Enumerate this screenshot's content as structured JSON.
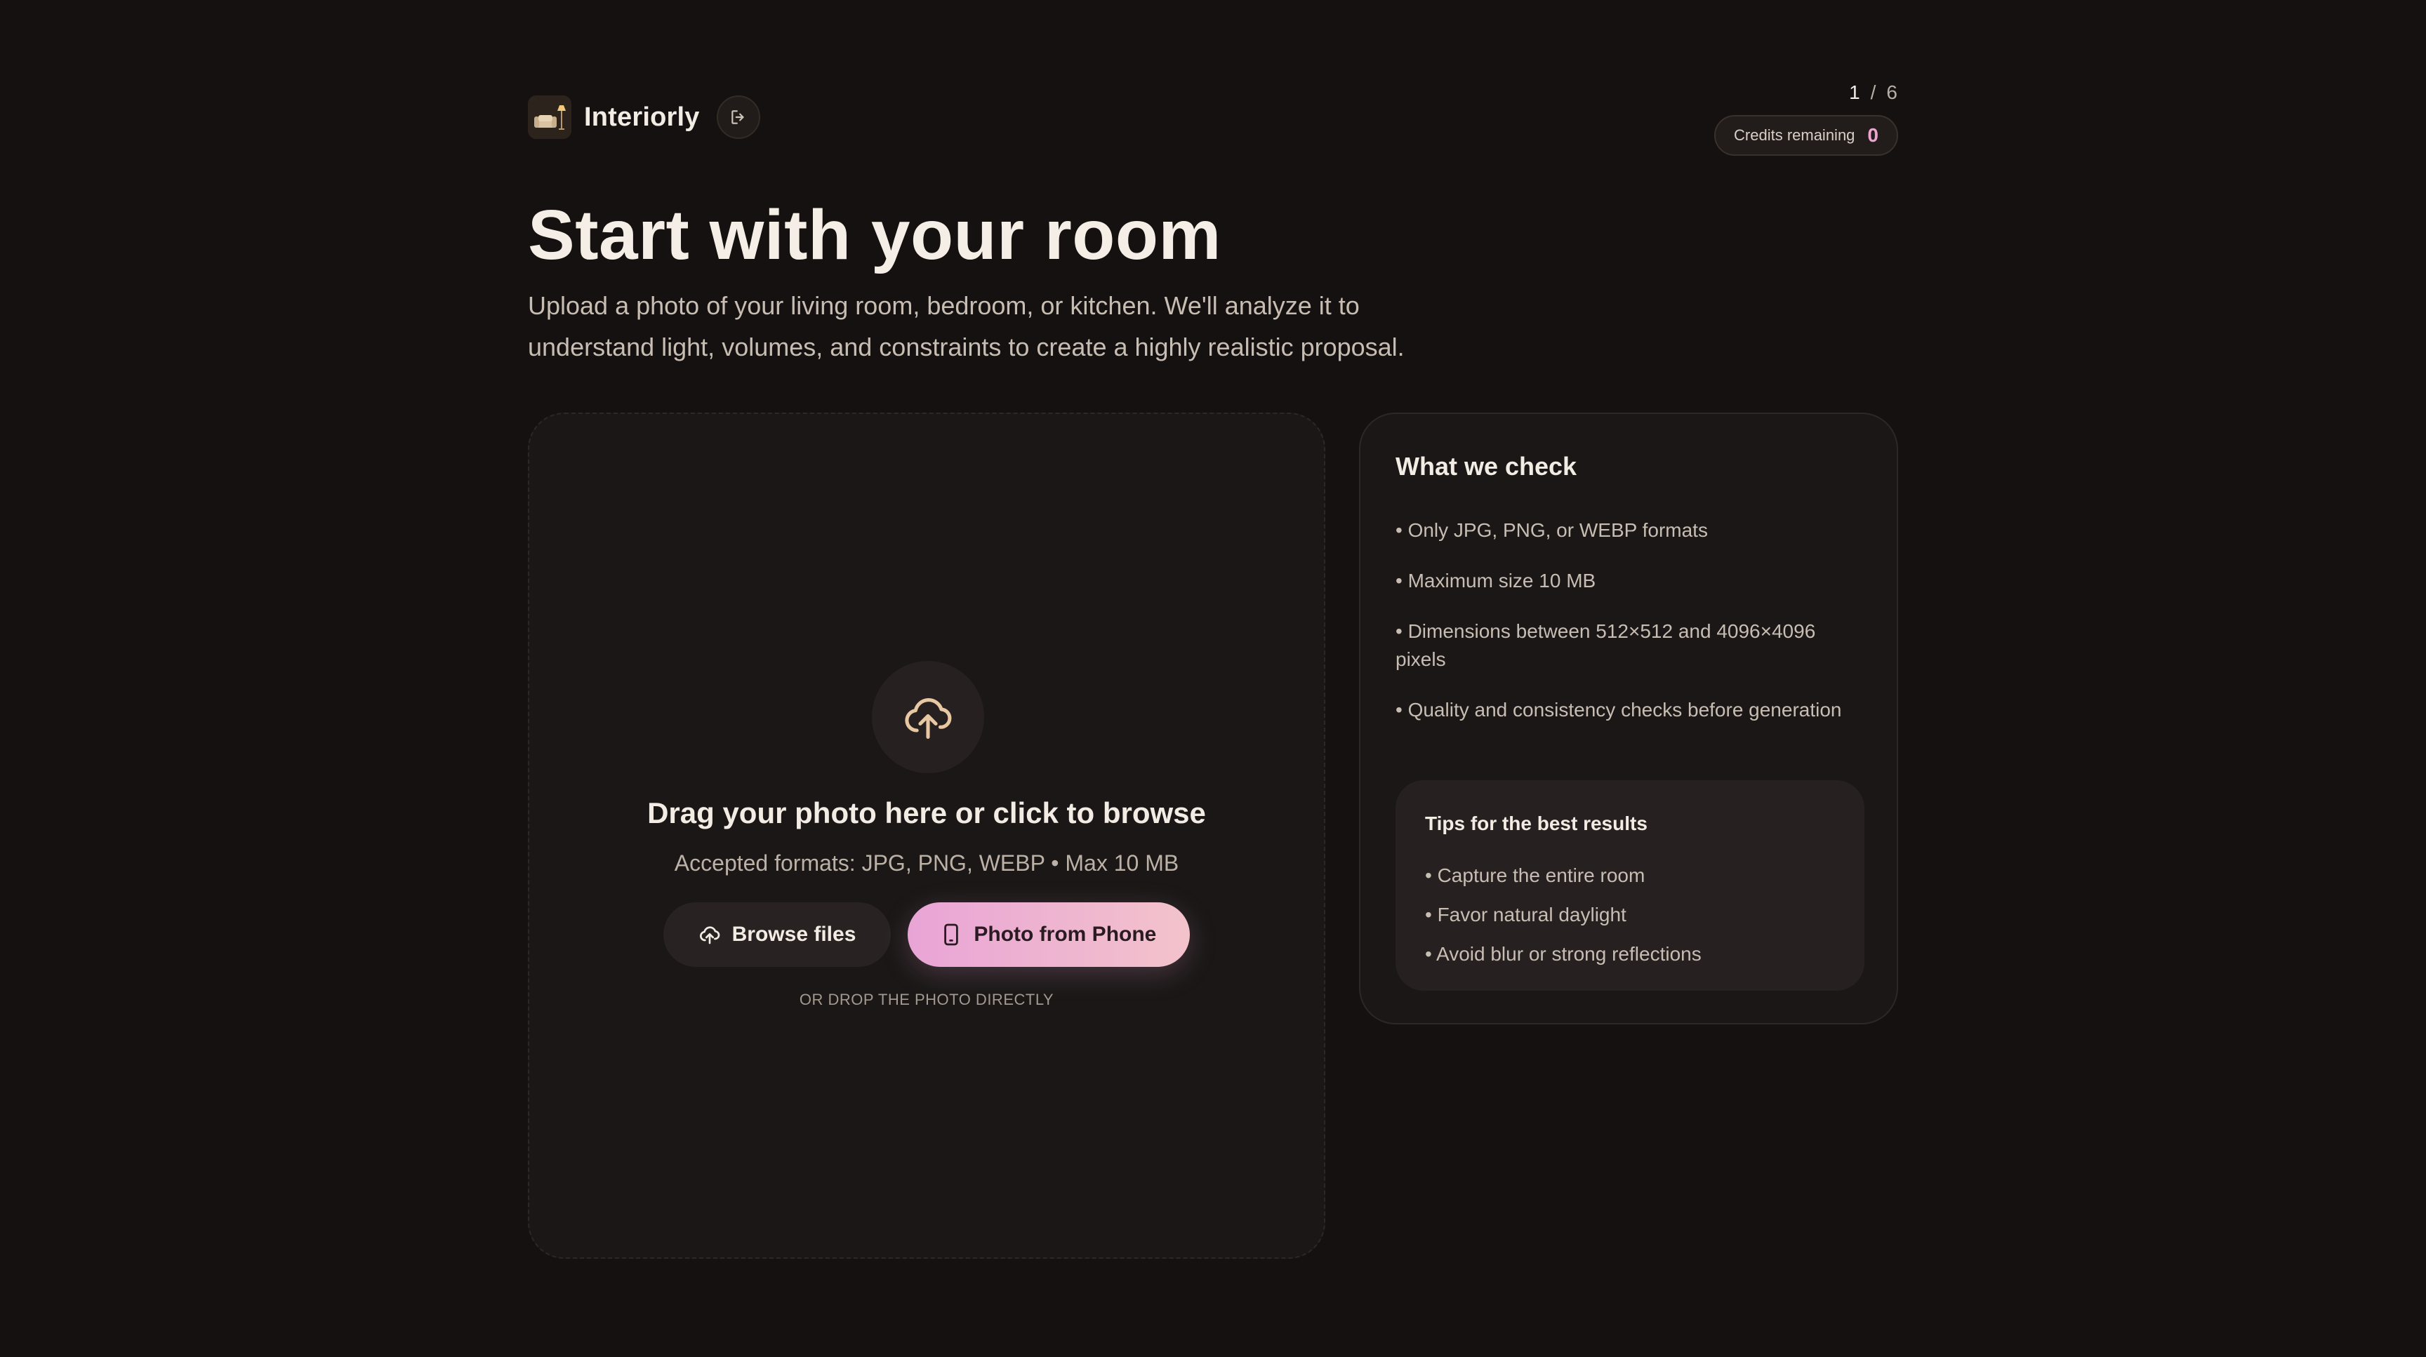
{
  "header": {
    "brand_name": "Interiorly",
    "step": {
      "current": "1",
      "separator": "/",
      "total": "6"
    },
    "credits": {
      "label": "Credits remaining",
      "value": "0"
    }
  },
  "hero": {
    "title": "Start with your room",
    "subtitle_line1": "Upload a photo of your living room, bedroom, or kitchen. We'll analyze it to",
    "subtitle_line2": "understand light, volumes, and constraints to create a highly realistic proposal."
  },
  "dropzone": {
    "icon": "cloud-upload-icon",
    "title": "Drag your photo here or click to browse",
    "formats": "Accepted formats: JPG, PNG, WEBP • Max 10 MB",
    "browse_label": "Browse files",
    "phone_label": "Photo from Phone",
    "drop_hint": "OR DROP THE PHOTO DIRECTLY"
  },
  "checks": {
    "title": "What we check",
    "items": [
      "• Only JPG, PNG, or WEBP formats",
      "• Maximum size 10 MB",
      "• Dimensions between 512×512 and 4096×4096 pixels",
      "• Quality and consistency checks before generation"
    ],
    "tips": {
      "title": "Tips for the best results",
      "items": [
        "• Capture the entire room",
        "• Favor natural daylight",
        "• Avoid blur or strong reflections"
      ]
    }
  },
  "colors": {
    "background": "#141110",
    "card": "#1a1716",
    "accent_pink": "#e9a4d6",
    "accent_peach": "#f3c3cb",
    "icon_gold": "#e8c7a3"
  }
}
